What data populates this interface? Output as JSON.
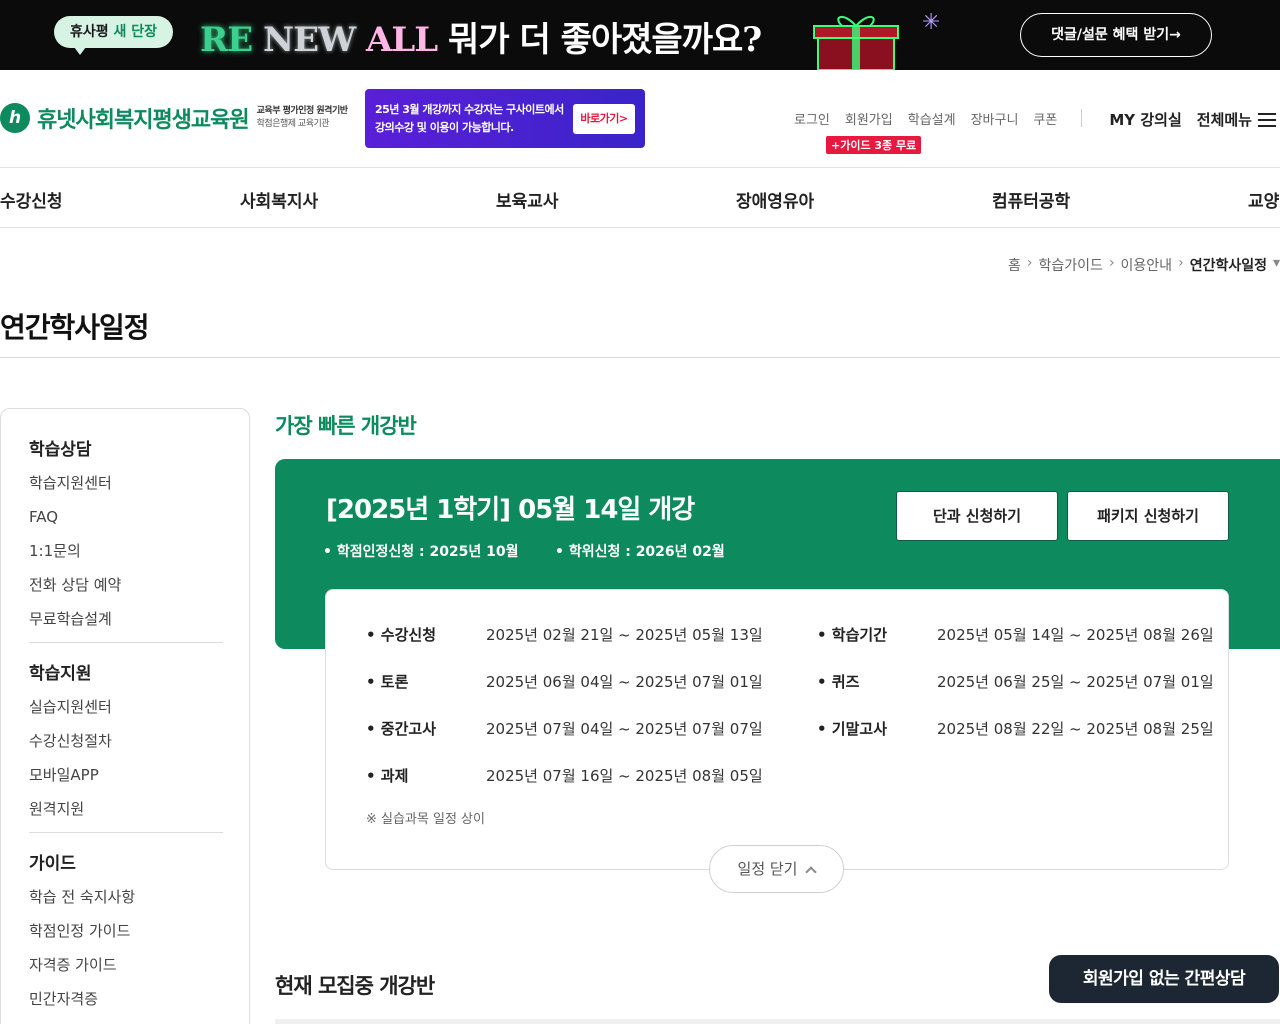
{
  "promo": {
    "tag_prefix": "휴사평",
    "tag_emphasis": "새 단장",
    "headline_part1": "RE",
    "headline_part2": " NEW",
    "headline_part3": " ALL",
    "headline_part4": " 뭐가 더 좋아졌을까요?",
    "cta": "댓글/설문 혜택 받기→"
  },
  "header": {
    "logo_mark": "h",
    "logo_name": "휴넷사회복지평생교육원",
    "logo_sub1": "교육부 평가인정 원격기반",
    "logo_sub2": "학점은행제 교육기관",
    "ad_line1": "25년 3월 개강까지 수강자는 구사이트에서",
    "ad_line2": "강의수강 및 이용이 가능합니다.",
    "ad_button": "바로가기>",
    "util": [
      "로그인",
      "회원가입",
      "학습설계",
      "장바구니",
      "쿠폰"
    ],
    "guide_badge": "+가이드 3종 무료",
    "my": "MY 강의실",
    "all_menu": "전체메뉴"
  },
  "gnb": [
    "수강신청",
    "사회복지사",
    "보육교사",
    "장애영유아",
    "컴퓨터공학",
    "교양"
  ],
  "breadcrumb": [
    "홈",
    "학습가이드",
    "이용안내",
    "연간학사일정"
  ],
  "page_title": "연간학사일정",
  "sidebar": {
    "groups": [
      {
        "title": "학습상담",
        "items": [
          "학습지원센터",
          "FAQ",
          "1:1문의",
          "전화 상담 예약",
          "무료학습설계"
        ]
      },
      {
        "title": "학습지원",
        "items": [
          "실습지원센터",
          "수강신청절차",
          "모바일APP",
          "원격지원"
        ]
      },
      {
        "title": "가이드",
        "items": [
          "학습 전 숙지사항",
          "학점인정 가이드",
          "자격증 가이드",
          "민간자격증"
        ]
      }
    ]
  },
  "main": {
    "section_title": "가장 빠른 개강반",
    "card_title": "[2025년 1학기] 05월 14일 개강",
    "meta1": "• 학점인정신청 : 2025년 10월",
    "meta2": "• 학위신청 : 2026년 02월",
    "btn_single": "단과 신청하기",
    "btn_package": "패키지 신청하기",
    "schedule": [
      {
        "label": "• 수강신청",
        "value": "2025년 02월 21일 ~ 2025년 05월 13일"
      },
      {
        "label": "• 학습기간",
        "value": "2025년 05월 14일 ~ 2025년 08월 26일"
      },
      {
        "label": "• 토론",
        "value": "2025년 06월 04일 ~ 2025년 07월 01일"
      },
      {
        "label": "• 퀴즈",
        "value": "2025년 06월 25일 ~ 2025년 07월 01일"
      },
      {
        "label": "• 중간고사",
        "value": "2025년 07월 04일 ~ 2025년 07월 07일"
      },
      {
        "label": "• 기말고사",
        "value": "2025년 08월 22일 ~ 2025년 08월 25일"
      },
      {
        "label": "• 과제",
        "value": "2025년 07월 16일 ~ 2025년 08월 05일"
      }
    ],
    "note": "※ 실습과목 일정 상이",
    "toggle": "일정 닫기",
    "section2_title": "현재 모집중 개강반"
  },
  "float_button": "회원가입 없는 간편상담",
  "colors": {
    "brand": "#0e8a5f",
    "accent": "#e8183f"
  }
}
